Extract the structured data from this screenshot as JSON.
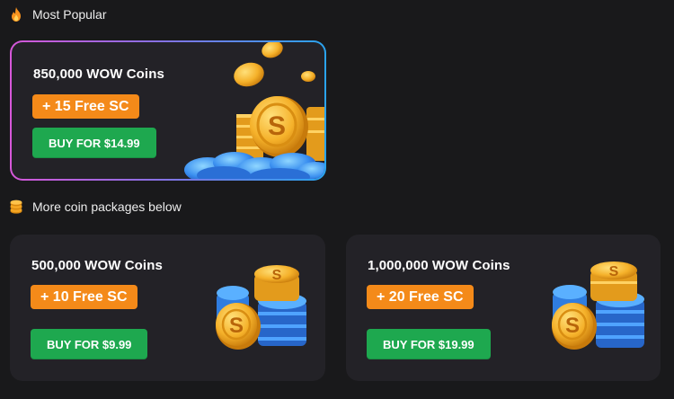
{
  "sections": {
    "popular": {
      "label": "Most Popular",
      "icon": "fire-icon"
    },
    "more": {
      "label": "More coin packages below",
      "icon": "coin-stack-icon"
    }
  },
  "featured": {
    "title": "850,000 WOW Coins",
    "bonus": "+ 15 Free SC",
    "button": "BUY FOR $14.99"
  },
  "packages": [
    {
      "title": "500,000 WOW Coins",
      "bonus": "+ 10 Free SC",
      "button": "BUY FOR $9.99"
    },
    {
      "title": "1,000,000 WOW Coins",
      "bonus": "+ 20 Free SC",
      "button": "BUY FOR $19.99"
    }
  ],
  "colors": {
    "background": "#19191b",
    "card": "#232227",
    "bonus_badge": "#f48a19",
    "buy_button": "#1ea84f",
    "featured_border_start": "#d657d9",
    "featured_border_end": "#2aa3ee",
    "coin_gold": "#f5b12a",
    "coin_blue": "#2f7de0"
  }
}
